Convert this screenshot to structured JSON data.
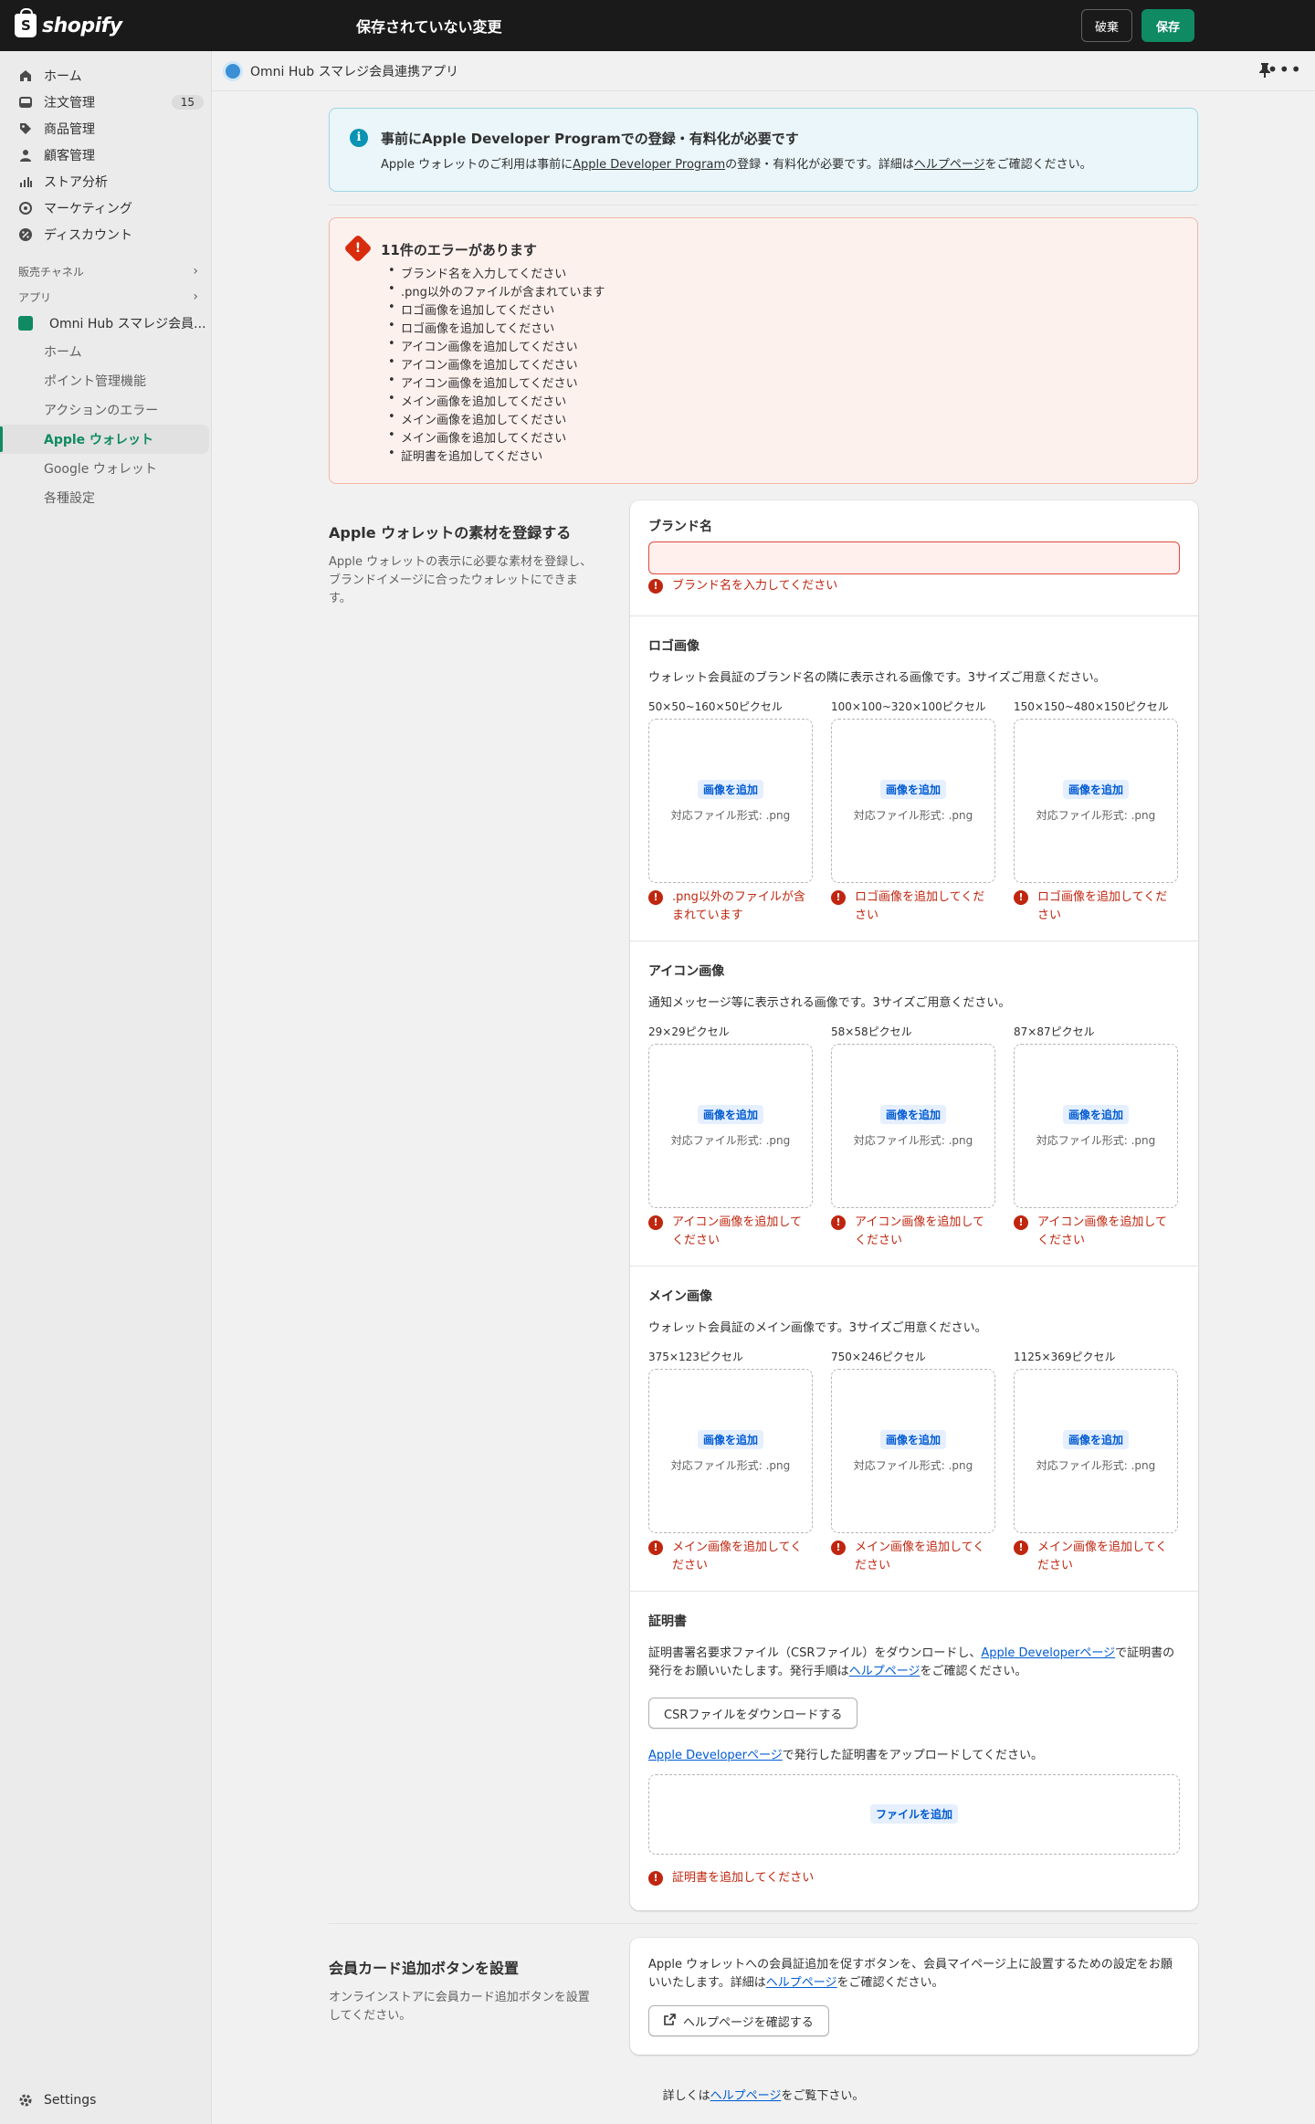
{
  "topbar": {
    "logo_text": "shopify",
    "unsaved": "保存されていない変更",
    "discard": "破棄",
    "save": "保存"
  },
  "sidebar": {
    "items": [
      {
        "label": "ホーム",
        "icon": "home-icon"
      },
      {
        "label": "注文管理",
        "icon": "orders-icon",
        "badge": "15"
      },
      {
        "label": "商品管理",
        "icon": "tag-icon"
      },
      {
        "label": "顧客管理",
        "icon": "person-icon"
      },
      {
        "label": "ストア分析",
        "icon": "chart-icon"
      },
      {
        "label": "マーケティング",
        "icon": "target-icon"
      },
      {
        "label": "ディスカウント",
        "icon": "discount-icon"
      }
    ],
    "sales_channels": "販売チャネル",
    "apps": "アプリ",
    "app_name": "Omni Hub スマレジ会員...",
    "sub_items": [
      "ホーム",
      "ポイント管理機能",
      "アクションのエラー",
      "Apple ウォレット",
      "Google ウォレット",
      "各種設定"
    ],
    "active_index": 3,
    "settings": "Settings"
  },
  "app_header": {
    "title": "Omni Hub スマレジ会員連携アプリ"
  },
  "info_banner": {
    "title": "事前にApple Developer Programでの登録・有料化が必要です",
    "body_prefix": "Apple ウォレットのご利用は事前に",
    "body_link": "Apple Developer Program",
    "body_middle": "の登録・有料化が必要です。詳細は",
    "body_link2": "ヘルプページ",
    "body_suffix": "をご確認ください。"
  },
  "error_banner": {
    "title": "11件のエラーがあります",
    "errors": [
      "ブランド名を入力してください",
      ".png以外のファイルが含まれています",
      "ロゴ画像を追加してください",
      "ロゴ画像を追加してください",
      "アイコン画像を追加してください",
      "アイコン画像を追加してください",
      "アイコン画像を追加してください",
      "メイン画像を追加してください",
      "メイン画像を追加してください",
      "メイン画像を追加してください",
      "証明書を追加してください"
    ]
  },
  "section1": {
    "title": "Apple ウォレットの素材を登録する",
    "desc": "Apple ウォレットの表示に必要な素材を登録し、ブランドイメージに合ったウォレットにできます。",
    "brand": {
      "label": "ブランド名",
      "value": "",
      "error": "ブランド名を入力してください"
    },
    "add_image": "画像を追加",
    "format_hint": "対応ファイル形式: .png",
    "logo": {
      "label": "ロゴ画像",
      "help": "ウォレット会員証のブランド名の隣に表示される画像です。3サイズご用意ください。",
      "sizes": [
        "50×50~160×50ピクセル",
        "100×100~320×100ピクセル",
        "150×150~480×150ピクセル"
      ],
      "errors": [
        ".png以外のファイルが含まれています",
        "ロゴ画像を追加してください",
        "ロゴ画像を追加してください"
      ]
    },
    "icon": {
      "label": "アイコン画像",
      "help": "通知メッセージ等に表示される画像です。3サイズご用意ください。",
      "sizes": [
        "29×29ピクセル",
        "58×58ピクセル",
        "87×87ピクセル"
      ],
      "errors": [
        "アイコン画像を追加してください",
        "アイコン画像を追加してください",
        "アイコン画像を追加してください"
      ]
    },
    "main": {
      "label": "メイン画像",
      "help": "ウォレット会員証のメイン画像です。3サイズご用意ください。",
      "sizes": [
        "375×123ピクセル",
        "750×246ピクセル",
        "1125×369ピクセル"
      ],
      "errors": [
        "メイン画像を追加してください",
        "メイン画像を追加してください",
        "メイン画像を追加してください"
      ]
    },
    "cert": {
      "label": "証明書",
      "help_prefix": "証明書署名要求ファイル（CSRファイル）をダウンロードし、",
      "help_link": "Apple Developerページ",
      "help_middle": "で証明書の発行をお願いいたします。発行手順は",
      "help_link2": "ヘルプページ",
      "help_suffix": "をご確認ください。",
      "download_btn": "CSRファイルをダウンロードする",
      "upload_link": "Apple Developerページ",
      "upload_text": "で発行した証明書をアップロードしてください。",
      "add_file": "ファイルを追加",
      "error": "証明書を追加してください"
    }
  },
  "section2": {
    "title": "会員カード追加ボタンを設置",
    "desc": "オンラインストアに会員カード追加ボタンを設置してください。",
    "text_prefix": "Apple ウォレットへの会員証追加を促すボタンを、会員マイページ上に設置するための設定をお願いいたします。詳細は",
    "text_link": "ヘルプページ",
    "text_suffix": "をご確認ください。",
    "button": "ヘルプページを確認する"
  },
  "footer": {
    "prefix": "詳しくは",
    "link": "ヘルプページ",
    "suffix": "をご覧下さい。"
  }
}
